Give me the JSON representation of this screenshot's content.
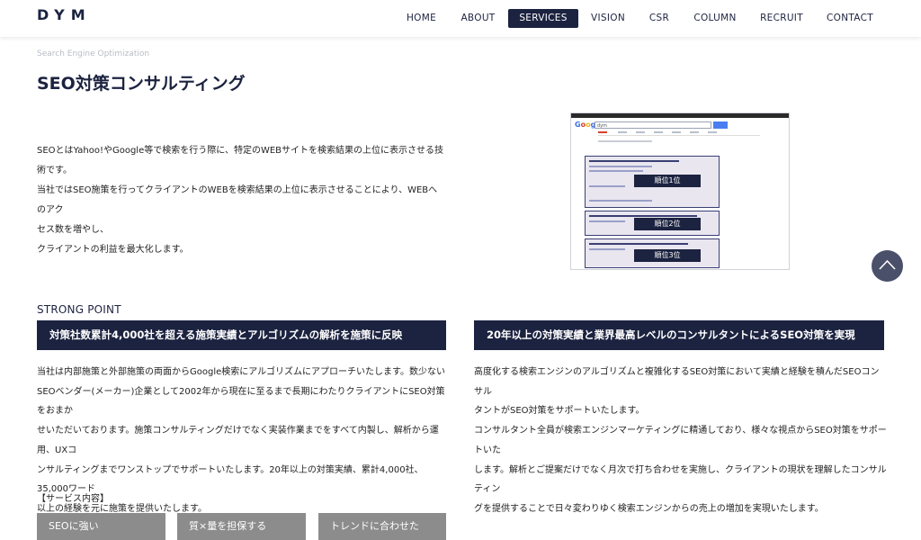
{
  "header": {
    "logo": "DYM",
    "nav": [
      {
        "label": "HOME",
        "active": false
      },
      {
        "label": "ABOUT",
        "active": false
      },
      {
        "label": "SERVICES",
        "active": true
      },
      {
        "label": "VISION",
        "active": false
      },
      {
        "label": "CSR",
        "active": false
      },
      {
        "label": "COLUMN",
        "active": false
      },
      {
        "label": "RECRUIT",
        "active": false
      },
      {
        "label": "CONTACT",
        "active": false
      }
    ]
  },
  "page": {
    "kicker": "Search Engine Optimization",
    "title": "SEO対策コンサルティング",
    "intro": [
      "SEOとはYahoo!やGoogle等で検索を行う際に、特定のWEBサイトを検索結果の上位に表示させる技",
      "術です。",
      "当社ではSEO施策を行ってクライアントのWEBを検索結果の上位に表示させることにより、WEBへのアク",
      "セス数を増やし、",
      "クライアントの利益を最大化します。"
    ]
  },
  "screenshot": {
    "logo_letters": [
      "G",
      "o",
      "o",
      "g",
      "l",
      "e"
    ],
    "search_text": "dym",
    "ranks": [
      "順位1位",
      "順位2位",
      "順位3位"
    ]
  },
  "strong_point": {
    "label": "STRONG POINT",
    "left": {
      "heading": "対策社数累計4,000社を超える施策実績とアルゴリズムの解析を施策に反映",
      "lines": [
        "当社は内部施策と外部施策の両面からGoogle検索にアルゴリズムにアプローチいたします。数少ない",
        "SEOベンダー(メーカー)企業として2002年から現在に至るまで長期にわたりクライアントにSEO対策をおまか",
        "せいただいております。施策コンサルティングだけでなく実装作業までをすべて内製し、解析から運用、UXコ",
        "ンサルティングまでワンストップでサポートいたします。20年以上の対策実績、累計4,000社、35,000ワード",
        "以上の経験を元に施策を提供いたします。"
      ]
    },
    "right": {
      "heading": "20年以上の対策実績と業界最高レベルのコンサルタントによるSEO対策を実現",
      "lines": [
        "高度化する検索エンジンのアルゴリズムと複雑化するSEO対策において実績と経験を積んだSEOコンサル",
        "タントがSEO対策をサポートいたします。",
        "コンサルタント全員が検索エンジンマーケティングに精通しており、様々な視点からSEO対策をサポートいた",
        "します。解析とご提案だけでなく月次で打ち合わせを実施し、クライアントの現状を理解したコンサルティン",
        "グを提供することで日々変わりゆく検索エンジンからの売上の増加を実現いたします。"
      ]
    }
  },
  "services": {
    "label": "【サービス内容】",
    "items": [
      "SEOに強い",
      "質×量を担保する",
      "トレンドに合わせた"
    ]
  },
  "colors": {
    "navy": "#1c2340",
    "gray_button": "#8c8c8c",
    "scroll_top": "#4a4f6a"
  },
  "icons": {
    "scroll_top": "chevron-up-icon"
  }
}
